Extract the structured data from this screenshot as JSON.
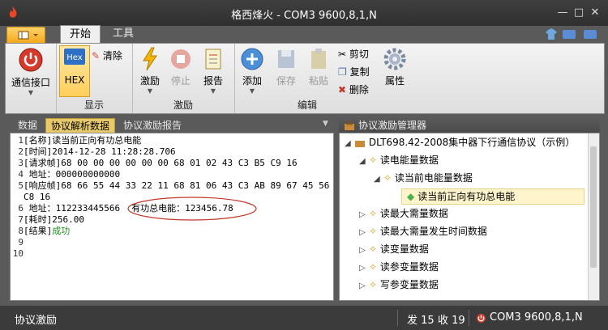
{
  "window": {
    "title": "格西烽火 - COM3  9600,8,1,N"
  },
  "tabs": [
    {
      "label": "开始"
    },
    {
      "label": "工具"
    }
  ],
  "ribbon": {
    "comm_label": "通信接口",
    "hex_label": "HEX",
    "hex_icon_text": "Hex",
    "clear_label": "清除",
    "display_group": "显示",
    "stimulus_label": "激励",
    "stop_label": "停止",
    "report_label": "报告",
    "stimulus_group": "激励",
    "add_label": "添加",
    "save_label": "保存",
    "paste_label": "粘贴",
    "cut_label": "剪切",
    "copy_label": "复制",
    "delete_label": "删除",
    "properties_label": "属性",
    "edit_group": "编辑"
  },
  "left_tabs": [
    {
      "label": "数据"
    },
    {
      "label": "协议解析数据"
    },
    {
      "label": "协议激励报告"
    }
  ],
  "right_header": "协议激励管理器",
  "log": {
    "line1": "[名称]读当前正向有功总电能",
    "line2": "[时间]2014-12-28 11:28:28.706",
    "line3": "[请求帧]68 00 00 00 00 00 00 68 01 02 43 C3 B5 C9 16",
    "line4": " 地址：000000000000",
    "line5a": "[响应帧]68 66 55 44 33 22 11 68 81 06 43 C3 AB 89 67 45 56",
    "line5b": "C8 16",
    "line6_addr": " 地址：112233445566",
    "line6_energy": "有功总电能：123456.78",
    "line7": "[耗时]256.00",
    "line8_prefix": "[结果]",
    "line8_result": "成功",
    "line_numbers": [
      "1",
      "2",
      "3",
      "4",
      "5",
      "",
      "6",
      "7",
      "8",
      "9",
      "10"
    ]
  },
  "tree": {
    "root": "DLT698.42-2008集中器下行通信协议（示例）",
    "n1": "读电能量数据",
    "n1a": "读当前电能量数据",
    "n1a1": "读当前正向有功总电能",
    "n2": "读最大需量数据",
    "n3": "读最大需量发生时间数据",
    "n4": "读变量数据",
    "n5": "读参变量数据",
    "n6": "写参变量数据"
  },
  "status": {
    "left": "协议激励",
    "sent": "发 15",
    "recv": "收 19",
    "port": "COM3  9600,8,1,N"
  },
  "colors": {
    "accent": "#f3a81d",
    "success": "#1a8a1a",
    "highlight": "#fff4cc",
    "circle": "#c0392b"
  }
}
